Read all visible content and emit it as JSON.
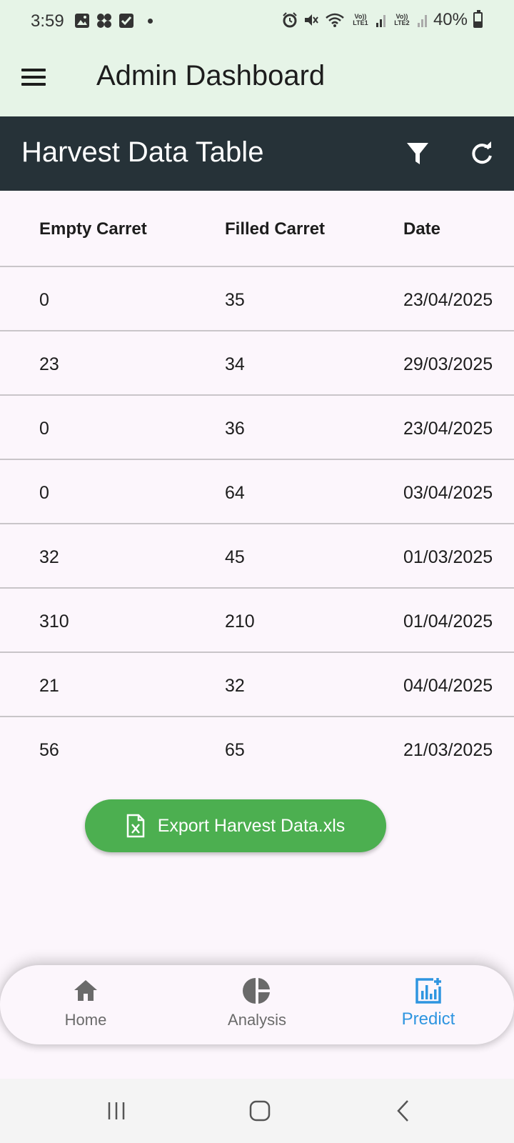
{
  "status_bar": {
    "time": "3:59",
    "network_1": "Vo)) LTE1",
    "network_2": "Vo)) LTE2",
    "battery": "40%"
  },
  "app_bar": {
    "title": "Admin Dashboard",
    "menu_icon": "menu-icon"
  },
  "table_header": {
    "title": "Harvest Data Table",
    "filter_icon": "filter-icon",
    "refresh_icon": "refresh-icon",
    "background": "#263238"
  },
  "table": {
    "columns": [
      "Empty Carret",
      "Filled Carret",
      "Date"
    ],
    "rows": [
      [
        "0",
        "35",
        "23/04/2025"
      ],
      [
        "23",
        "34",
        "29/03/2025"
      ],
      [
        "0",
        "36",
        "23/04/2025"
      ],
      [
        "0",
        "64",
        "03/04/2025"
      ],
      [
        "32",
        "45",
        "01/03/2025"
      ],
      [
        "310",
        "210",
        "01/04/2025"
      ],
      [
        "21",
        "32",
        "04/04/2025"
      ],
      [
        "56",
        "65",
        "21/03/2025"
      ]
    ]
  },
  "export_button": {
    "label": "Export Harvest Data.xls",
    "icon": "excel-file-icon",
    "color": "#4caf50"
  },
  "bottom_nav": {
    "items": [
      {
        "label": "Home",
        "icon": "home-icon",
        "active": false
      },
      {
        "label": "Analysis",
        "icon": "pie-chart-icon",
        "active": false
      },
      {
        "label": "Predict",
        "icon": "predict-chart-icon",
        "active": true
      }
    ],
    "active_color": "#2e95e0"
  },
  "system_nav": {
    "recent_icon": "recent-apps-icon",
    "home_icon": "system-home-icon",
    "back_icon": "back-icon"
  }
}
